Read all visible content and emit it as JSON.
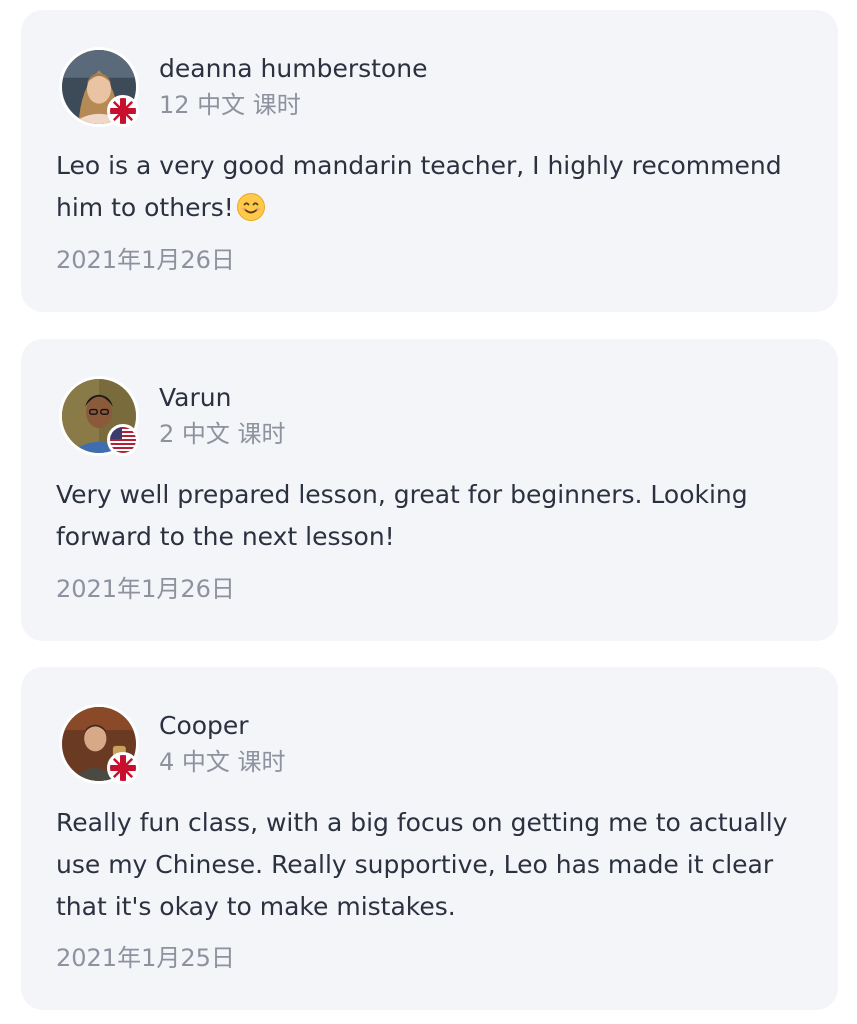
{
  "reviews": [
    {
      "reviewer": "deanna humberstone",
      "lessons": "12 中文 课时",
      "comment": "Leo is a very good mandarin teacher, I highly recommend him to others!",
      "emoji": "smiling-face-emoji",
      "date": "2021年1月26日",
      "flag": "uk-flag-icon"
    },
    {
      "reviewer": "Varun",
      "lessons": "2 中文 课时",
      "comment": "Very well prepared lesson, great for beginners. Looking forward to the next lesson!",
      "date": "2021年1月26日",
      "flag": "us-flag-icon"
    },
    {
      "reviewer": "Cooper",
      "lessons": "4 中文 课时",
      "comment": "Really fun class, with a big focus on getting me to actually use my Chinese. Really supportive, Leo has made it clear that it's okay to make mistakes.",
      "date": "2021年1月25日",
      "flag": "uk-flag-icon"
    }
  ],
  "colors": {
    "card_background": "#f3f5f9",
    "primary_text": "#2c3140",
    "secondary_text": "#8d929e"
  }
}
